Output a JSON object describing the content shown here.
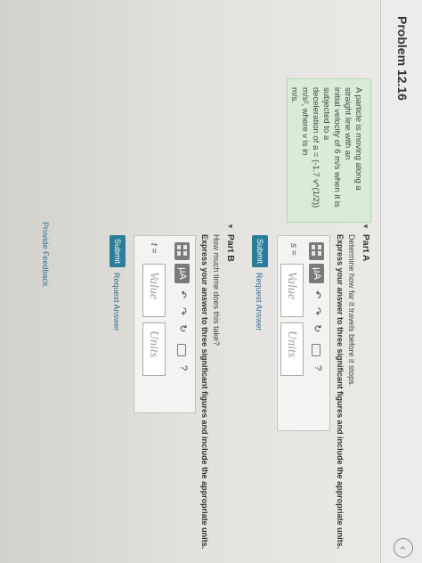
{
  "header": {
    "title": "Problem 12.16",
    "nav_icon": "chevron-left-icon",
    "nav_glyph": "‹"
  },
  "problem": {
    "line1": "A particle is moving along a straight line with an",
    "line2": "initial velocity of 6  m/s when it is subjected to a",
    "line3": "deceleration of a = (-1.7 v^(1/2)) m/s², where v is in",
    "line4": "m/s."
  },
  "part_a": {
    "toggle_glyph": "▼",
    "title": "Part A",
    "question": "Determine how far it travels before it stops.",
    "instruction": "Express your answer to three significant figures and include the appropriate units.",
    "variable": "s =",
    "value_placeholder": "Value",
    "units_placeholder": "Units",
    "submit_label": "Submit",
    "request_label": "Request Answer"
  },
  "part_b": {
    "toggle_glyph": "▼",
    "title": "Part B",
    "question": "How much time does this take?",
    "instruction": "Express your answer to three significant figures and include the appropriate units.",
    "variable": "t =",
    "value_placeholder": "Value",
    "units_placeholder": "Units",
    "submit_label": "Submit",
    "request_label": "Request Answer"
  },
  "toolbar": {
    "mu_label": "μA",
    "undo_glyph": "↶",
    "redo_glyph": "↷",
    "reset_glyph": "↻",
    "help_glyph": "?"
  },
  "footer": {
    "feedback_label": "Provide Feedback"
  },
  "colors": {
    "submit": "#2a7e9a",
    "link": "#2f6f97",
    "problem_box": "#d8ecd6"
  }
}
